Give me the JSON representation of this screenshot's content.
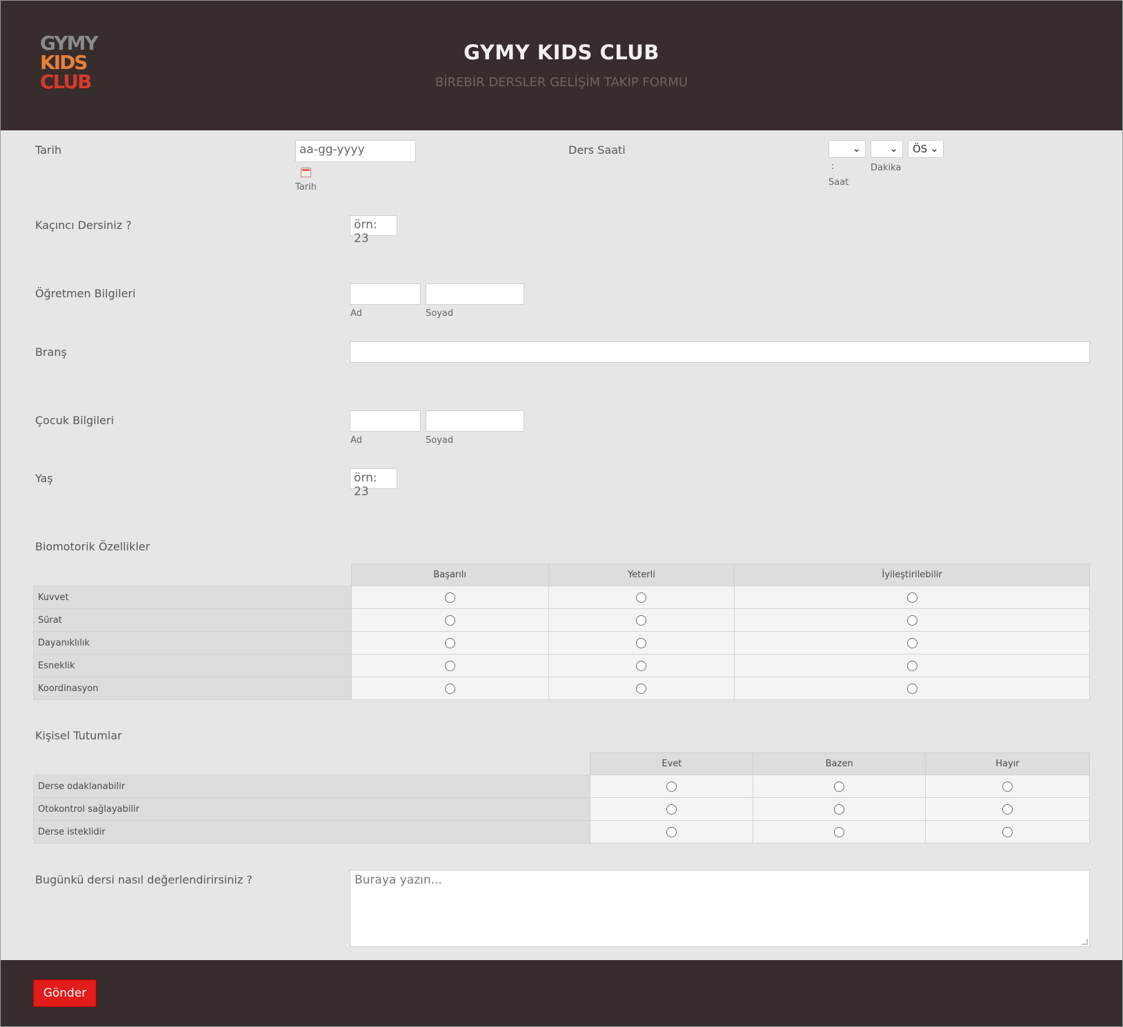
{
  "header": {
    "logo_lines": [
      "GYMY",
      "KIDS",
      "CLUB"
    ],
    "title": "GYMY KIDS CLUB",
    "subtitle": "BİREBİR DERSLER GELİŞİM TAKİP FORMU"
  },
  "colors": {
    "header_bg": "#372d2c",
    "form_bg": "#e6e6e6",
    "submit_bg": "#e21b1b",
    "logo_gray": "#8a8a8a",
    "logo_red": "#d83a2a",
    "logo_orange": "#e8803a"
  },
  "date": {
    "label": "Tarih",
    "placeholder": "aa-gg-yyyy",
    "sublabel": "Tarih",
    "icon": "calendar-icon"
  },
  "time": {
    "label": "Ders Saati",
    "hour_value": "",
    "minute_value": "",
    "ampm_value": "ÖS",
    "separator": ":",
    "hour_sublabel": "Saat",
    "minute_sublabel": "Dakika"
  },
  "lesson_number": {
    "label": "Kaçıncı Dersiniz ?",
    "placeholder": "örn: 23"
  },
  "teacher": {
    "label": "Öğretmen Bilgileri",
    "first_value": "",
    "last_value": "",
    "first_sublabel": "Ad",
    "last_sublabel": "Soyad"
  },
  "branch": {
    "label": "Branş",
    "value": ""
  },
  "child": {
    "label": "Çocuk Bilgileri",
    "first_value": "",
    "last_value": "",
    "first_sublabel": "Ad",
    "last_sublabel": "Soyad"
  },
  "age": {
    "label": "Yaş",
    "placeholder": "örn: 23"
  },
  "biomotor": {
    "label": "Biomotorik Özellikler",
    "columns": [
      "Başarılı",
      "Yeterli",
      "İyileştirilebilir"
    ],
    "rows": [
      "Kuvvet",
      "Sürat",
      "Dayanıklılık",
      "Esneklik",
      "Koordinasyon"
    ]
  },
  "attitudes": {
    "label": "Kişisel Tutumlar",
    "columns": [
      "Evet",
      "Bazen",
      "Hayır"
    ],
    "rows": [
      "Derse odaklanabilir",
      "Otokontrol sağlayabilir",
      "Derse isteklidir"
    ]
  },
  "evaluation": {
    "label": "Bugünkü dersi nasıl değerlendirirsiniz ?",
    "placeholder": "Buraya yazın..."
  },
  "footer": {
    "submit_label": "Gönder"
  }
}
